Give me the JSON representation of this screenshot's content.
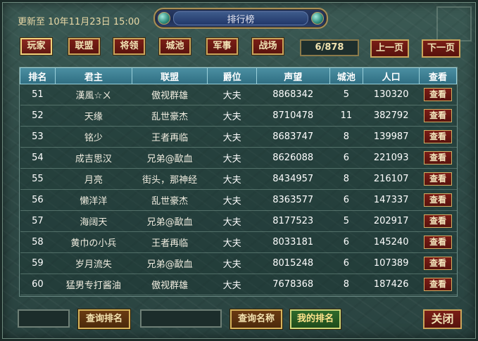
{
  "window": {
    "title": "排行榜",
    "updated": "更新至 10年11月23日 15:00"
  },
  "tabs": [
    {
      "label": "玩家",
      "active": true
    },
    {
      "label": "联盟",
      "active": false
    },
    {
      "label": "将领",
      "active": false
    },
    {
      "label": "城池",
      "active": false
    },
    {
      "label": "军事",
      "active": false
    },
    {
      "label": "战场",
      "active": false
    }
  ],
  "pager": {
    "page": "6/878",
    "prev_label": "上一页",
    "next_label": "下一页"
  },
  "table": {
    "columns": [
      "排名",
      "君主",
      "联盟",
      "爵位",
      "声望",
      "城池",
      "人口",
      "查看"
    ],
    "view_label": "查看",
    "rows": [
      {
        "rank": "51",
        "lord": "漢風☆ㄨ",
        "alliance": "傲视群雄",
        "title": "大夫",
        "prestige": "8868342",
        "cities": "5",
        "population": "130320"
      },
      {
        "rank": "52",
        "lord": "天缘",
        "alliance": "乱世豪杰",
        "title": "大夫",
        "prestige": "8710478",
        "cities": "11",
        "population": "382792"
      },
      {
        "rank": "53",
        "lord": "铭少",
        "alliance": "王者再临",
        "title": "大夫",
        "prestige": "8683747",
        "cities": "8",
        "population": "139987"
      },
      {
        "rank": "54",
        "lord": "成吉思汉",
        "alliance": "兄弟@歃血",
        "title": "大夫",
        "prestige": "8626088",
        "cities": "6",
        "population": "221093"
      },
      {
        "rank": "55",
        "lord": "月亮",
        "alliance": "街头，那神经",
        "title": "大夫",
        "prestige": "8434957",
        "cities": "8",
        "population": "216107"
      },
      {
        "rank": "56",
        "lord": "懒洋洋",
        "alliance": "乱世豪杰",
        "title": "大夫",
        "prestige": "8363577",
        "cities": "6",
        "population": "147337"
      },
      {
        "rank": "57",
        "lord": "海阔天",
        "alliance": "兄弟@歃血",
        "title": "大夫",
        "prestige": "8177523",
        "cities": "5",
        "population": "202917"
      },
      {
        "rank": "58",
        "lord": "黄巾の小兵",
        "alliance": "王者再临",
        "title": "大夫",
        "prestige": "8033181",
        "cities": "6",
        "population": "145240"
      },
      {
        "rank": "59",
        "lord": "岁月流失",
        "alliance": "兄弟@歃血",
        "title": "大夫",
        "prestige": "8015248",
        "cities": "6",
        "population": "107389"
      },
      {
        "rank": "60",
        "lord": "猛男专打酱油",
        "alliance": "傲视群雄",
        "title": "大夫",
        "prestige": "7678368",
        "cities": "8",
        "population": "187426"
      }
    ]
  },
  "footer": {
    "rank_query_value": "",
    "rank_query_label": "查询排名",
    "name_query_value": "",
    "name_query_label": "查询名称",
    "my_rank_label": "我的排名",
    "close_label": "关闭"
  }
}
